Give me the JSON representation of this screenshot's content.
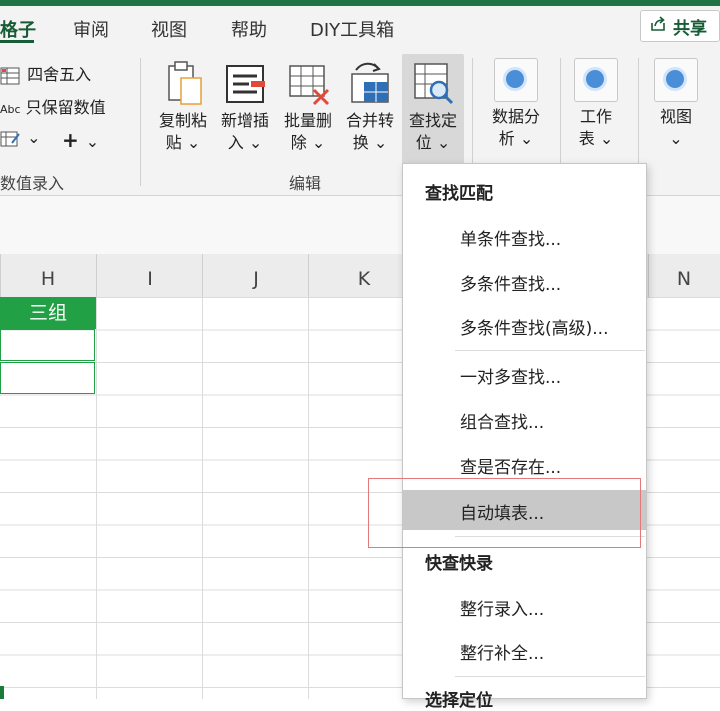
{
  "tabs": {
    "t0": "格子",
    "t1": "审阅",
    "t2": "视图",
    "t3": "帮助",
    "t4": "DIY工具箱",
    "share": "共享"
  },
  "ribbon": {
    "round": "四舍五入",
    "keep_values": "只保留数值",
    "abc_icon_text": "Abc",
    "plus_glyph": "+",
    "group_value_entry": "数值录入",
    "copy_paste": [
      "复制粘",
      "贴"
    ],
    "insert": [
      "新增插",
      "入"
    ],
    "batch_delete": [
      "批量删",
      "除"
    ],
    "merge_convert": [
      "合并转",
      "换"
    ],
    "find_locate": [
      "查找定",
      "位"
    ],
    "group_edit": "编辑",
    "data_analysis": [
      "数据分",
      "析"
    ],
    "worksheet": [
      "工作",
      "表"
    ],
    "view": "视图",
    "caret": "⌄"
  },
  "sheet": {
    "columns": [
      "H",
      "I",
      "J",
      "K",
      "N"
    ],
    "h1_value": "三组"
  },
  "dropdown": {
    "section1": "查找匹配",
    "items1": [
      "单条件查找...",
      "多条件查找...",
      "多条件查找(高级)...",
      "一对多查找...",
      "组合查找...",
      "查是否存在...",
      "自动填表..."
    ],
    "section2": "快查快录",
    "items2": [
      "整行录入...",
      "整行补全..."
    ],
    "section3": "选择定位"
  },
  "colors": {
    "accent": "#217346",
    "cell_green": "#21a045",
    "highlight_frame": "#e37a7a",
    "circle_icon": "#4a8ed8"
  },
  "icons": [
    "share-icon",
    "round-icon",
    "abc-icon",
    "entry-icon",
    "clipboard-icon",
    "insert-rows-icon",
    "delete-cells-icon",
    "merge-convert-icon",
    "find-table-icon",
    "circle-icon"
  ]
}
